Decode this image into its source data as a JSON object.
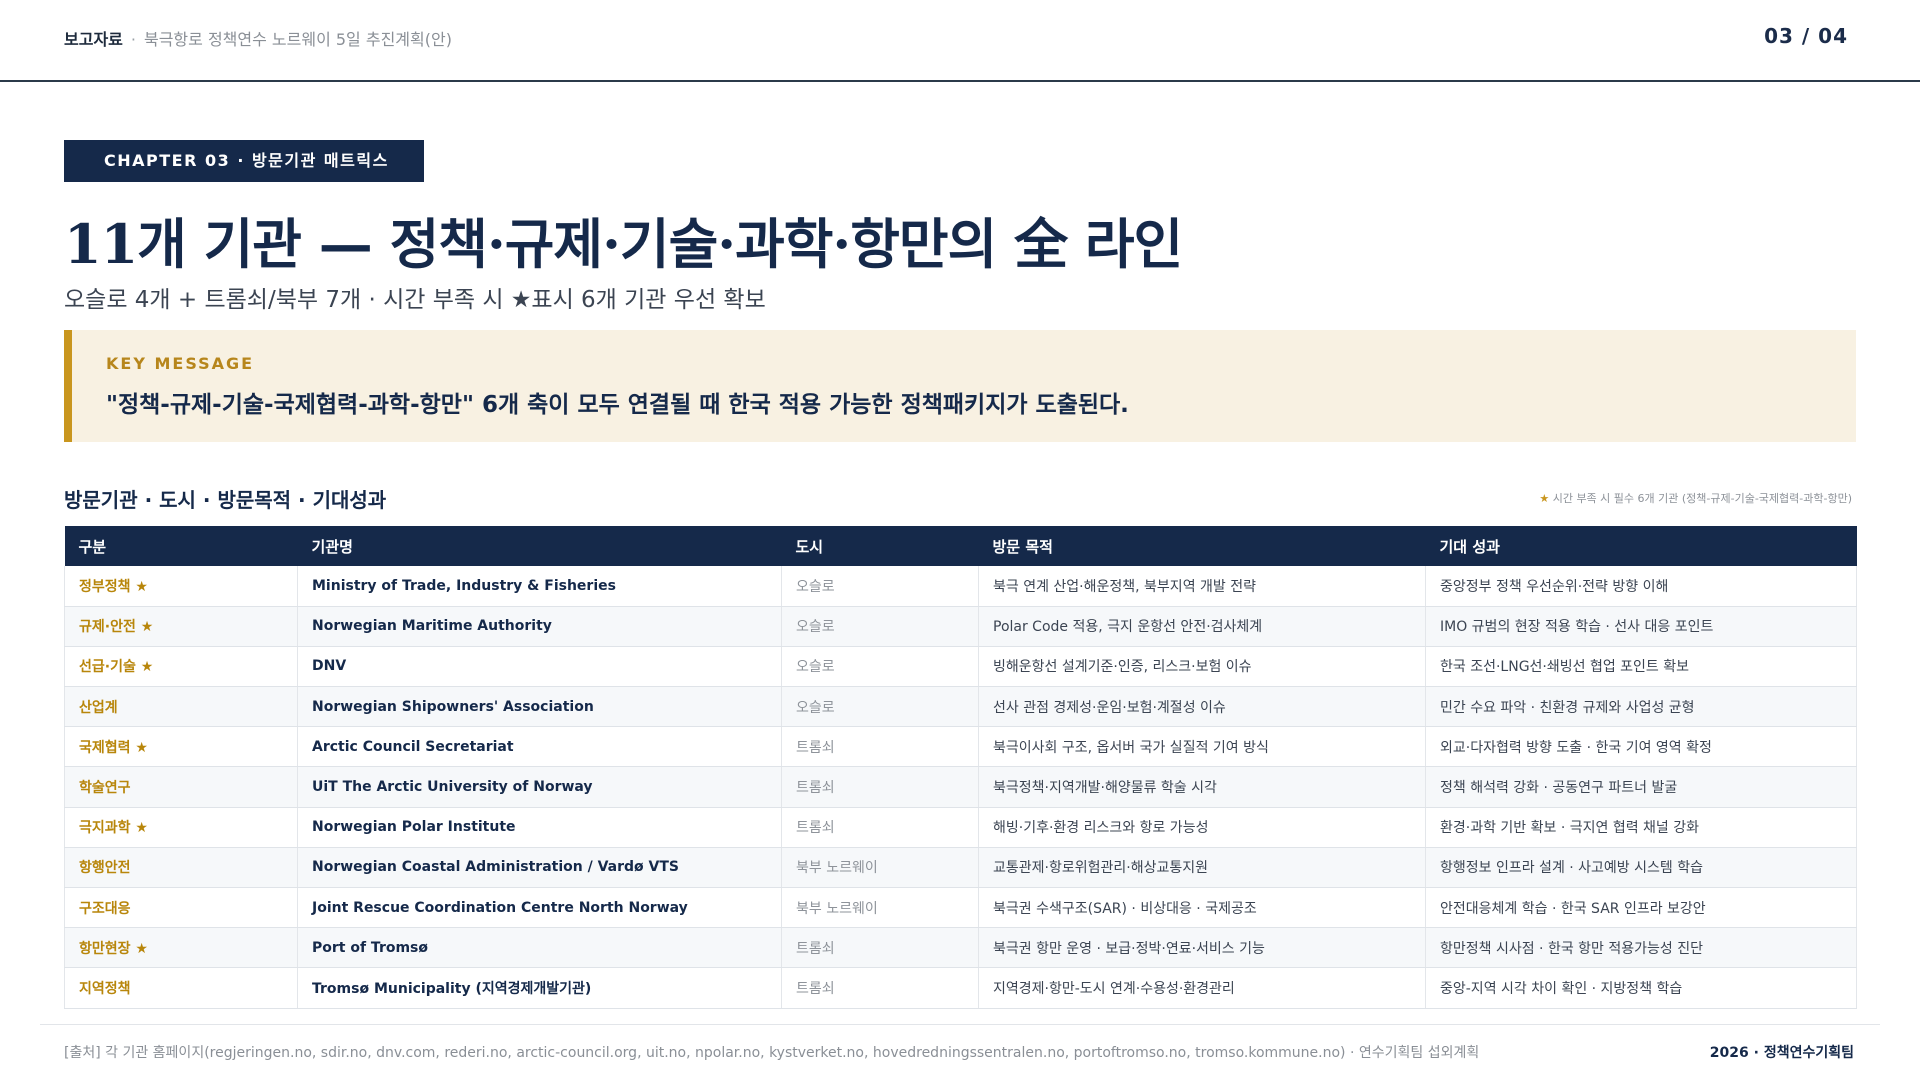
{
  "header": {
    "doc_type": "보고자료",
    "separator": "·",
    "doc_title": "북극항로 정책연수 노르웨이 5일 추진계획(안)",
    "page_indicator": "03 / 04"
  },
  "chapter_tag": "CHAPTER 03 · 방문기관 매트릭스",
  "title": "11개 기관 — 정책·규제·기술·과학·항만의 全 라인",
  "subtitle": "오슬로 4개 + 트롬쇠/북부 7개 · 시간 부족 시 ★표시 6개 기관 우선 확보",
  "key_message": {
    "label": "KEY MESSAGE",
    "text": "\"정책-규제-기술-국제협력-과학-항만\" 6개 축이 모두 연결될 때 한국 적용 가능한 정책패키지가 도출된다."
  },
  "section": {
    "title": "방문기관 · 도시 · 방문목적 · 기대성과",
    "note_star": "★",
    "note": "시간 부족 시 필수 6개 기관 (정책-규제-기술-국제협력-과학-항만)"
  },
  "table": {
    "headers": [
      "구분",
      "기관명",
      "도시",
      "방문 목적",
      "기대 성과"
    ],
    "rows": [
      {
        "category": "정부정책 ★",
        "org": "Ministry of Trade, Industry & Fisheries",
        "city": "오슬로",
        "purpose": "북극 연계 산업·해운정책, 북부지역 개발 전략",
        "result": "중앙정부 정책 우선순위·전략 방향 이해"
      },
      {
        "category": "규제·안전 ★",
        "org": "Norwegian Maritime Authority",
        "city": "오슬로",
        "purpose": "Polar Code 적용, 극지 운항선 안전·검사체계",
        "result": "IMO 규범의 현장 적용 학습 · 선사 대응 포인트"
      },
      {
        "category": "선급·기술 ★",
        "org": "DNV",
        "city": "오슬로",
        "purpose": "빙해운항선 설계기준·인증, 리스크·보험 이슈",
        "result": "한국 조선·LNG선·쇄빙선 협업 포인트 확보"
      },
      {
        "category": "산업계",
        "org": "Norwegian Shipowners' Association",
        "city": "오슬로",
        "purpose": "선사 관점 경제성·운임·보험·계절성 이슈",
        "result": "민간 수요 파악 · 친환경 규제와 사업성 균형"
      },
      {
        "category": "국제협력 ★",
        "org": "Arctic Council Secretariat",
        "city": "트롬쇠",
        "purpose": "북극이사회 구조, 옵서버 국가 실질적 기여 방식",
        "result": "외교·다자협력 방향 도출 · 한국 기여 영역 확정"
      },
      {
        "category": "학술연구",
        "org": "UiT The Arctic University of Norway",
        "city": "트롬쇠",
        "purpose": "북극정책·지역개발·해양물류 학술 시각",
        "result": "정책 해석력 강화 · 공동연구 파트너 발굴"
      },
      {
        "category": "극지과학 ★",
        "org": "Norwegian Polar Institute",
        "city": "트롬쇠",
        "purpose": "해빙·기후·환경 리스크와 항로 가능성",
        "result": "환경·과학 기반 확보 · 극지연 협력 채널 강화"
      },
      {
        "category": "항행안전",
        "org": "Norwegian Coastal Administration / Vardø VTS",
        "city": "북부 노르웨이",
        "purpose": "교통관제·항로위험관리·해상교통지원",
        "result": "항행정보 인프라 설계 · 사고예방 시스템 학습"
      },
      {
        "category": "구조대응",
        "org": "Joint Rescue Coordination Centre North Norway",
        "city": "북부 노르웨이",
        "purpose": "북극권 수색구조(SAR) · 비상대응 · 국제공조",
        "result": "안전대응체계 학습 · 한국 SAR 인프라 보강안"
      },
      {
        "category": "항만현장 ★",
        "org": "Port of Tromsø",
        "city": "트롬쇠",
        "purpose": "북극권 항만 운영 · 보급·정박·연료·서비스 기능",
        "result": "항만정책 시사점 · 한국 항만 적용가능성 진단"
      },
      {
        "category": "지역정책",
        "org": "Tromsø Municipality (지역경제개발기관)",
        "city": "트롬쇠",
        "purpose": "지역경제·항만-도시 연계·수용성·환경관리",
        "result": "중앙-지역 시각 차이 확인 · 지방정책 학습"
      }
    ]
  },
  "footer": {
    "source": "[출처] 각 기관 홈페이지(regjeringen.no, sdir.no, dnv.com, rederi.no, arctic-council.org, uit.no, npolar.no, kystverket.no, hovedredningssentralen.no, portoftromso.no, tromso.kommune.no) · 연수기획팀 섭외계획",
    "brand": "2026 · 정책연수기획팀"
  }
}
